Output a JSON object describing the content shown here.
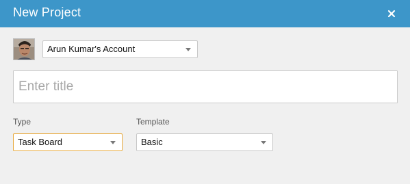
{
  "dialog": {
    "title": "New Project",
    "close_icon": "close-icon"
  },
  "account": {
    "avatar_icon": "user-avatar",
    "selected": "Arun Kumar's Account"
  },
  "title_field": {
    "value": "",
    "placeholder": "Enter title"
  },
  "type": {
    "label": "Type",
    "selected": "Task Board"
  },
  "template": {
    "label": "Template",
    "selected": "Basic"
  },
  "colors": {
    "header": "#3d96c9",
    "background": "#f0f0f0",
    "focus_border": "#e8a93a"
  }
}
